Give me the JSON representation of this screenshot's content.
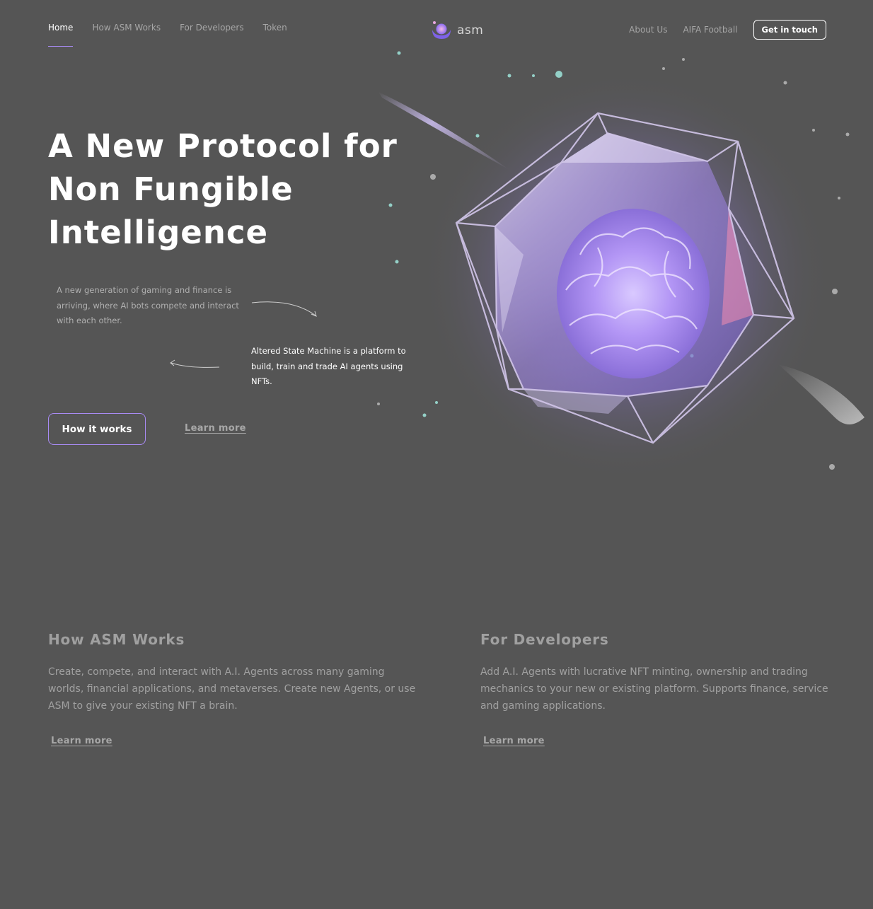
{
  "nav": {
    "left_items": [
      "Home",
      "How ASM Works",
      "For Developers",
      "Token"
    ],
    "right_items": [
      "About Us",
      "AIFA Football"
    ],
    "cta": "Get in touch",
    "logo_text": "asm",
    "active": "Home"
  },
  "hero": {
    "title_lines": [
      "A New Protocol for",
      "Non Fungible",
      "Intelligence"
    ],
    "intro": "A new generation of gaming and finance is arriving, where AI bots compete and interact with each other.",
    "asm_description": "Altered State Machine is a platform to build, train and trade AI agents using NFTs.",
    "primary_button": "How it works",
    "secondary_link": "Learn more"
  },
  "sections": [
    {
      "title": "How ASM Works",
      "text": "Create, compete, and interact with A.I. Agents across many gaming worlds, financial applications, and metaverses. Create new Agents, or use ASM to give your existing NFT a brain.",
      "link": "Learn more"
    },
    {
      "title": "For Developers",
      "text": "Add A.I. Agents with lucrative NFT minting, ownership and trading mechanics to your new or existing platform. Supports finance, service and gaming applications.",
      "link": "Learn more"
    }
  ],
  "colors": {
    "background": "#555555",
    "accent": "#a98bf5",
    "muted_text": "#a0a0a0"
  }
}
